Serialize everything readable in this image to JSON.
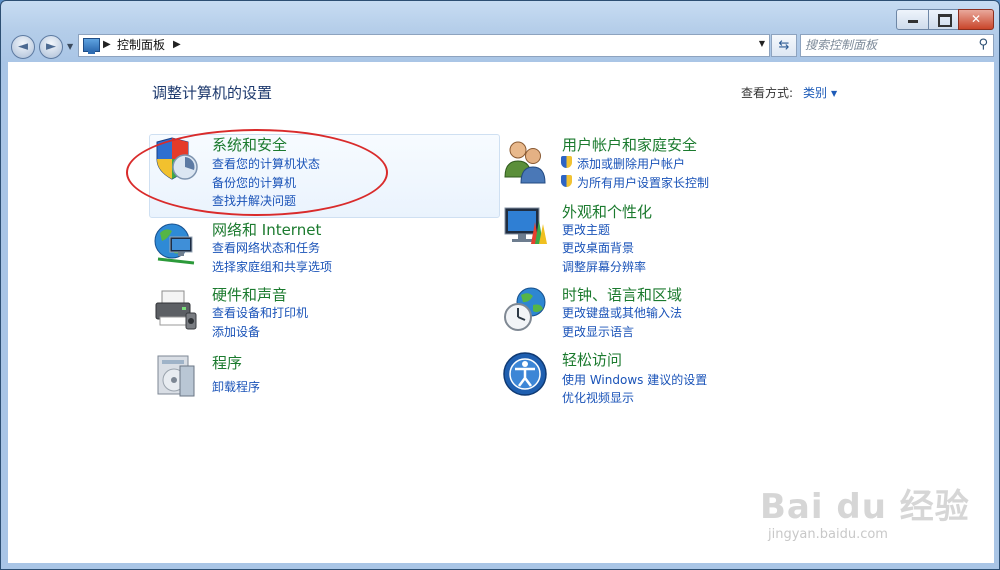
{
  "titlebar": {
    "minimize": "",
    "maximize": "",
    "close": "✕"
  },
  "nav": {
    "back": "◄",
    "forward": "►"
  },
  "address": {
    "crumb": "控制面板",
    "separator": "▶"
  },
  "search": {
    "placeholder": "搜索控制面板"
  },
  "page": {
    "heading": "调整计算机的设置",
    "view_label": "查看方式:",
    "view_value": "类别"
  },
  "categories_left": [
    {
      "title": "系统和安全",
      "icon": "shield-icon",
      "links": [
        "查看您的计算机状态",
        "备份您的计算机",
        "查找并解决问题"
      ]
    },
    {
      "title": "网络和 Internet",
      "icon": "network-icon",
      "links": [
        "查看网络状态和任务",
        "选择家庭组和共享选项"
      ]
    },
    {
      "title": "硬件和声音",
      "icon": "printer-icon",
      "links": [
        "查看设备和打印机",
        "添加设备"
      ]
    },
    {
      "title": "程序",
      "icon": "programs-icon",
      "links": [
        "卸载程序"
      ]
    }
  ],
  "categories_right": [
    {
      "title": "用户帐户和家庭安全",
      "icon": "users-icon",
      "links": [
        "添加或删除用户帐户",
        "为所有用户设置家长控制"
      ]
    },
    {
      "title": "外观和个性化",
      "icon": "appearance-icon",
      "links": [
        "更改主题",
        "更改桌面背景",
        "调整屏幕分辨率"
      ]
    },
    {
      "title": "时钟、语言和区域",
      "icon": "clock-globe-icon",
      "links": [
        "更改键盘或其他输入法",
        "更改显示语言"
      ]
    },
    {
      "title": "轻松访问",
      "icon": "ease-of-access-icon",
      "links": [
        "使用 Windows 建议的设置",
        "优化视频显示"
      ]
    }
  ],
  "watermark": {
    "brand": "Bai du 经验",
    "url": "jingyan.baidu.com"
  },
  "colors": {
    "category_title": "#1b7a2e",
    "link": "#1a53b8",
    "annotation": "#d92b2b"
  }
}
